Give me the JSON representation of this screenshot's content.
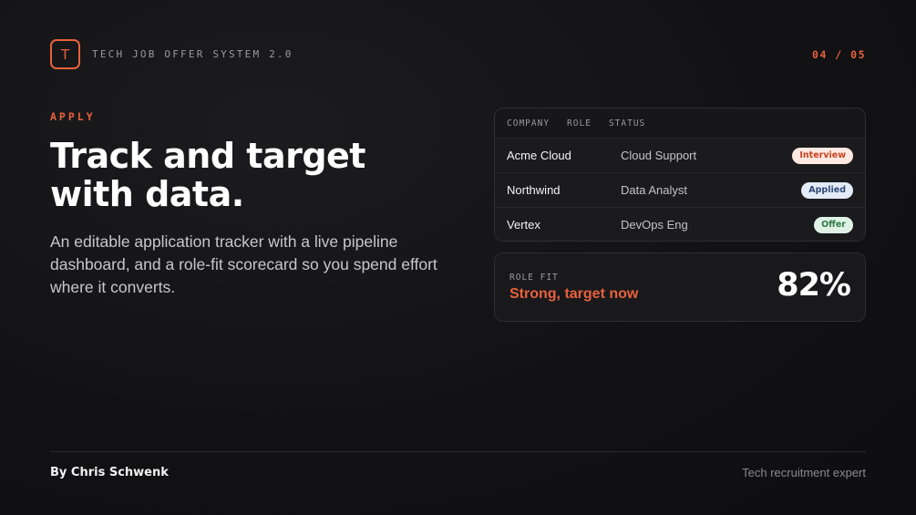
{
  "header": {
    "logo_letter": "T",
    "app_title": "TECH JOB OFFER SYSTEM 2.0",
    "page_counter": "04 / 05"
  },
  "hero": {
    "eyebrow": "APPLY",
    "headline_line1": "Track and target",
    "headline_line2": "with data.",
    "description": "An editable application tracker with a live pipeline dashboard, and a role-fit scorecard so you spend effort where it converts."
  },
  "tracker": {
    "columns": [
      "COMPANY",
      "ROLE",
      "STATUS"
    ],
    "rows": [
      {
        "company": "Acme Cloud",
        "role": "Cloud Support",
        "status": "Interview"
      },
      {
        "company": "Northwind",
        "role": "Data Analyst",
        "status": "Applied"
      },
      {
        "company": "Vertex",
        "role": "DevOps Eng",
        "status": "Offer"
      }
    ]
  },
  "role_fit": {
    "label": "ROLE FIT",
    "verdict": "Strong, target now",
    "score": "82%"
  },
  "footer": {
    "author": "By Chris Schwenk",
    "tagline": "Tech recruitment expert"
  },
  "colors": {
    "accent": "#e8613c",
    "background": "#121214",
    "interview_badge": "#fde8e2",
    "applied_badge": "#e3ebf6",
    "offer_badge": "#e0f2e6"
  }
}
